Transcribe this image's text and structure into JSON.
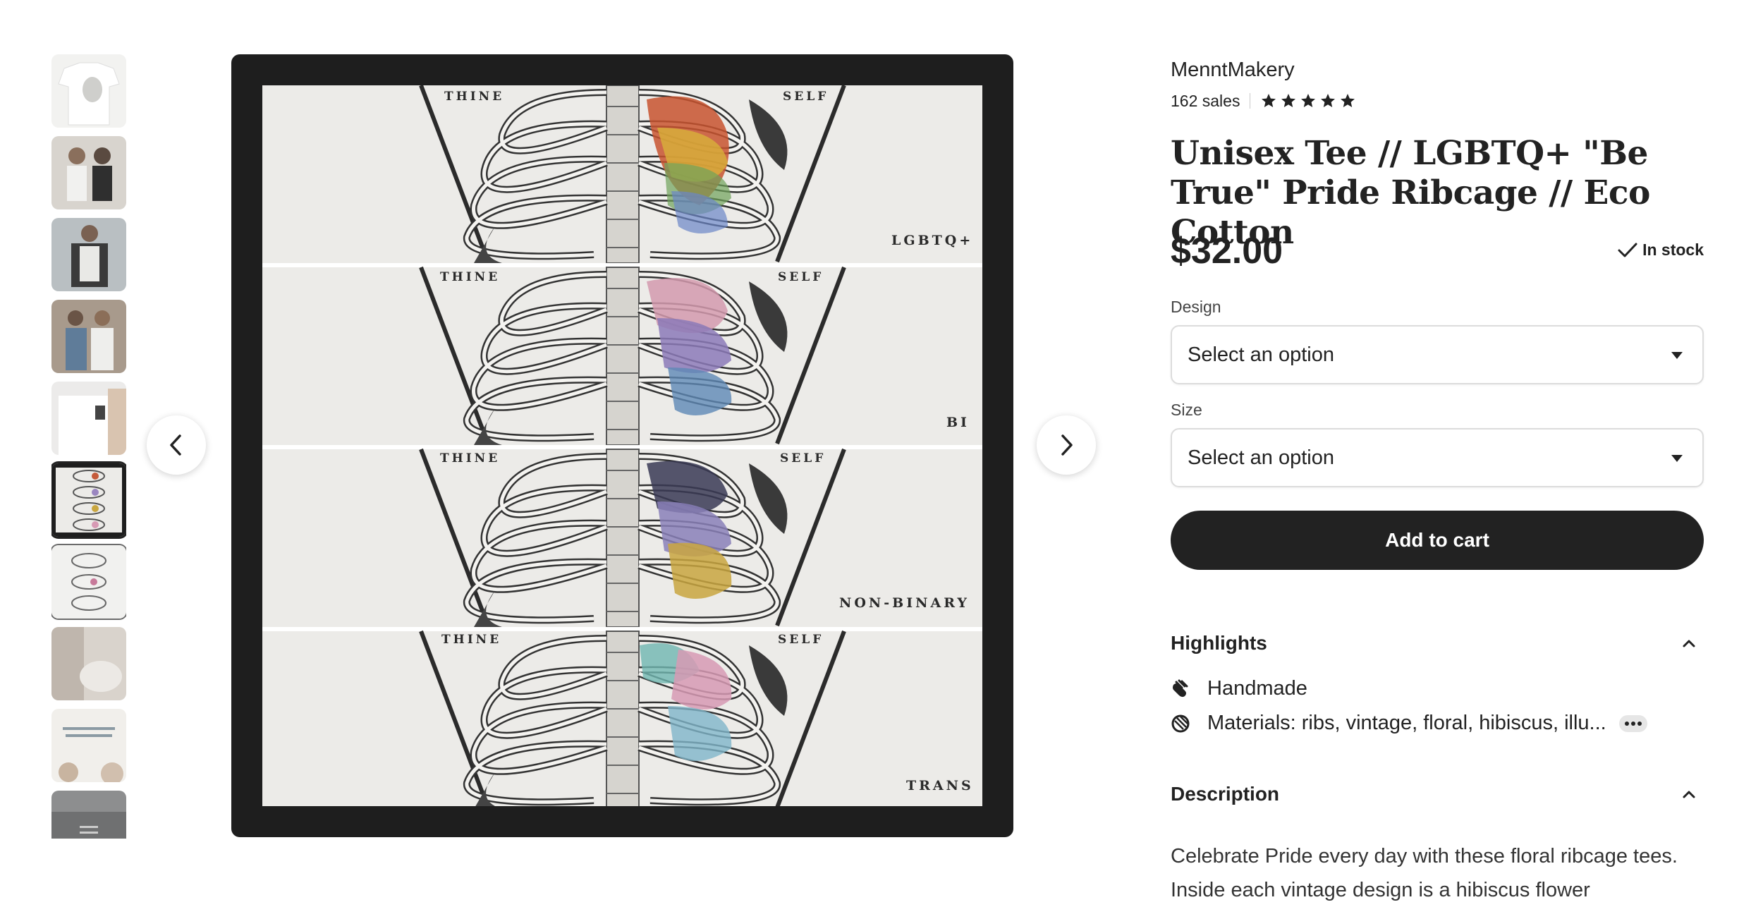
{
  "gallery": {
    "thumbnails": [
      {
        "alt": "thumb-1",
        "color": "#f0f0ee"
      },
      {
        "alt": "thumb-2",
        "color": "#c9c6c1"
      },
      {
        "alt": "thumb-3",
        "color": "#6f6f6c"
      },
      {
        "alt": "thumb-4",
        "color": "#9a8f85"
      },
      {
        "alt": "thumb-5",
        "color": "#e6e3df"
      },
      {
        "alt": "thumb-6",
        "color": "#3a3a3a"
      },
      {
        "alt": "thumb-7",
        "color": "#cfcfcf"
      },
      {
        "alt": "thumb-8",
        "color": "#d8d2cb"
      },
      {
        "alt": "thumb-9",
        "color": "#e9e5df"
      },
      {
        "alt": "thumb-10",
        "color": "#8c8c8c"
      }
    ],
    "selected_index": 5,
    "panel_labels": {
      "thine": "THINE",
      "self": "SELF",
      "p1": "LGBTQ+",
      "p2": "BI",
      "p3": "NON-BINARY",
      "p4": "TRANS"
    },
    "prev_icon": "chevron-left-icon",
    "next_icon": "chevron-right-icon"
  },
  "shop": {
    "name": "MenntMakery",
    "sales": "162 sales",
    "rating_stars": 5
  },
  "product": {
    "title": "Unisex Tee // LGBTQ+ \"Be True\" Pride Ribcage // Eco Cotton",
    "price": "$32.00",
    "stock": "In stock"
  },
  "options": {
    "design_label": "Design",
    "design_value": "Select an option",
    "size_label": "Size",
    "size_value": "Select an option"
  },
  "cart": {
    "label": "Add to cart"
  },
  "highlights": {
    "heading": "Highlights",
    "handmade": "Handmade",
    "materials": "Materials: ribs, vintage, floral, hibiscus, illu..."
  },
  "description": {
    "heading": "Description",
    "text": "Celebrate Pride every day with these floral ribcage tees. Inside each vintage design is a hibiscus flower"
  },
  "colors": {
    "accent": "#222222",
    "panel_bg": "#ecebe8",
    "frame": "#1e1e1e"
  }
}
